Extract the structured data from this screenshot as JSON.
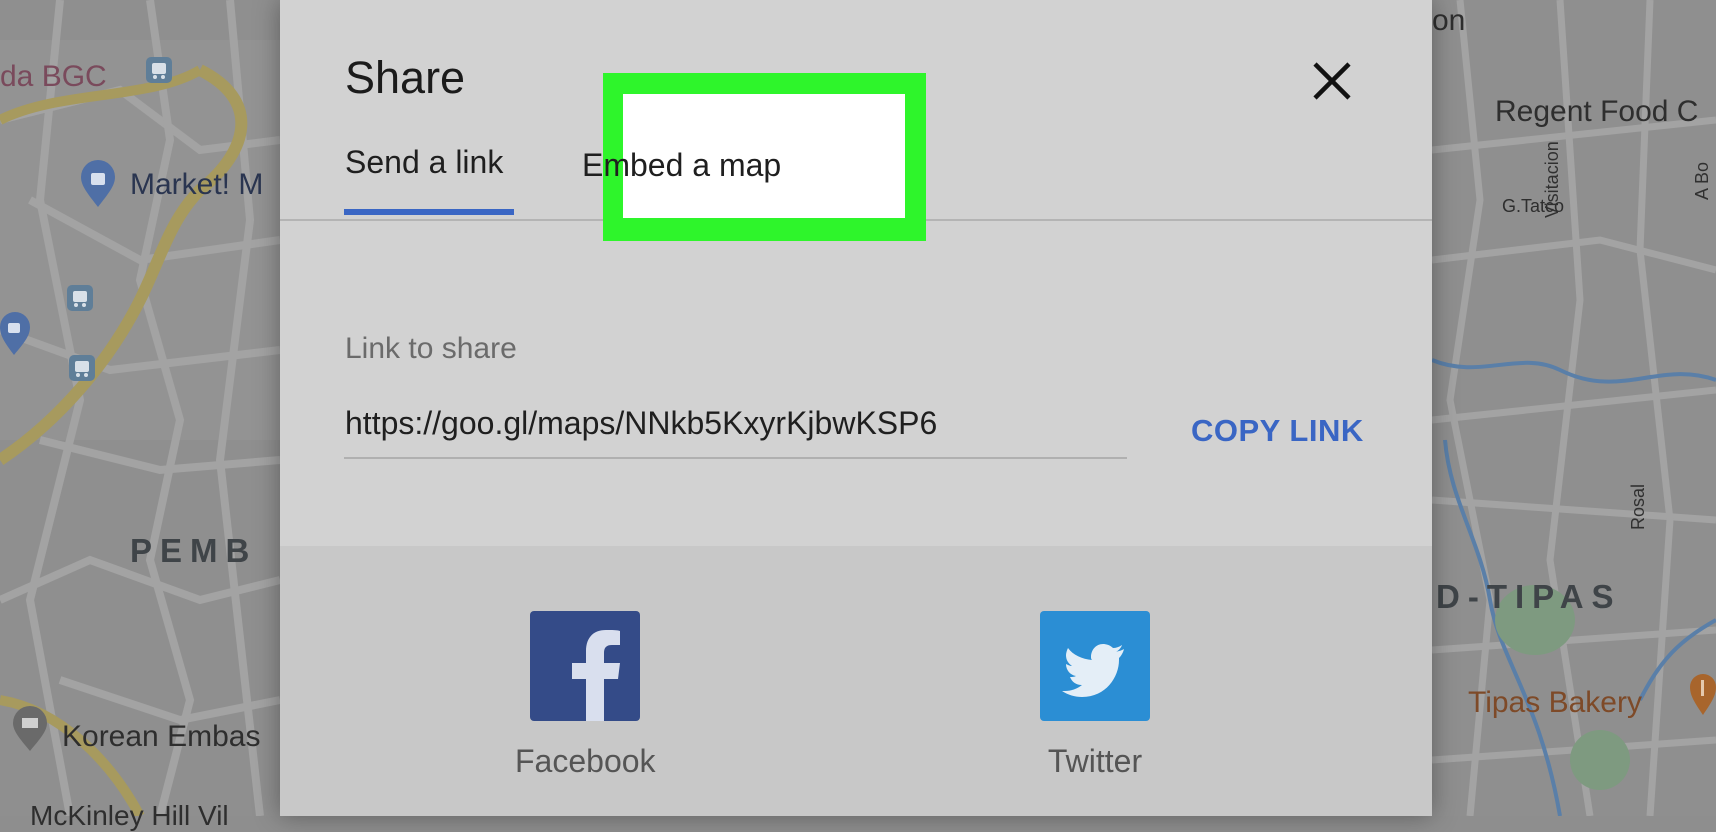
{
  "dialog": {
    "title": "Share",
    "close_icon": "close-icon",
    "tabs": [
      {
        "label": "Send a link",
        "active": true
      },
      {
        "label": "Embed a map",
        "active": false,
        "highlighted": true
      }
    ],
    "link_label": "Link to share",
    "link_value": "https://goo.gl/maps/NNkb5KxyrKjbwKSP6",
    "copy_link_label": "COPY LINK",
    "social": [
      {
        "name": "Facebook",
        "icon": "facebook-icon",
        "color": "#344b88"
      },
      {
        "name": "Twitter",
        "icon": "twitter-icon",
        "color": "#2b8ed4"
      }
    ]
  },
  "colors": {
    "accent": "#3a66c4",
    "highlight": "#2ef52b"
  },
  "map": {
    "labels": [
      {
        "text": "da BGC"
      },
      {
        "text": "Market! M"
      },
      {
        "text": "PEMB"
      },
      {
        "text": "Korean Embas"
      },
      {
        "text": "McKinley Hill Vil"
      },
      {
        "text": "on"
      },
      {
        "text": "Regent Food C"
      },
      {
        "text": "G.Tatco"
      },
      {
        "text": "Visitacion"
      },
      {
        "text": "Rosal"
      },
      {
        "text": "D-TIPAS"
      },
      {
        "text": "Tipas Bakery"
      },
      {
        "text": "A Bo"
      }
    ]
  }
}
